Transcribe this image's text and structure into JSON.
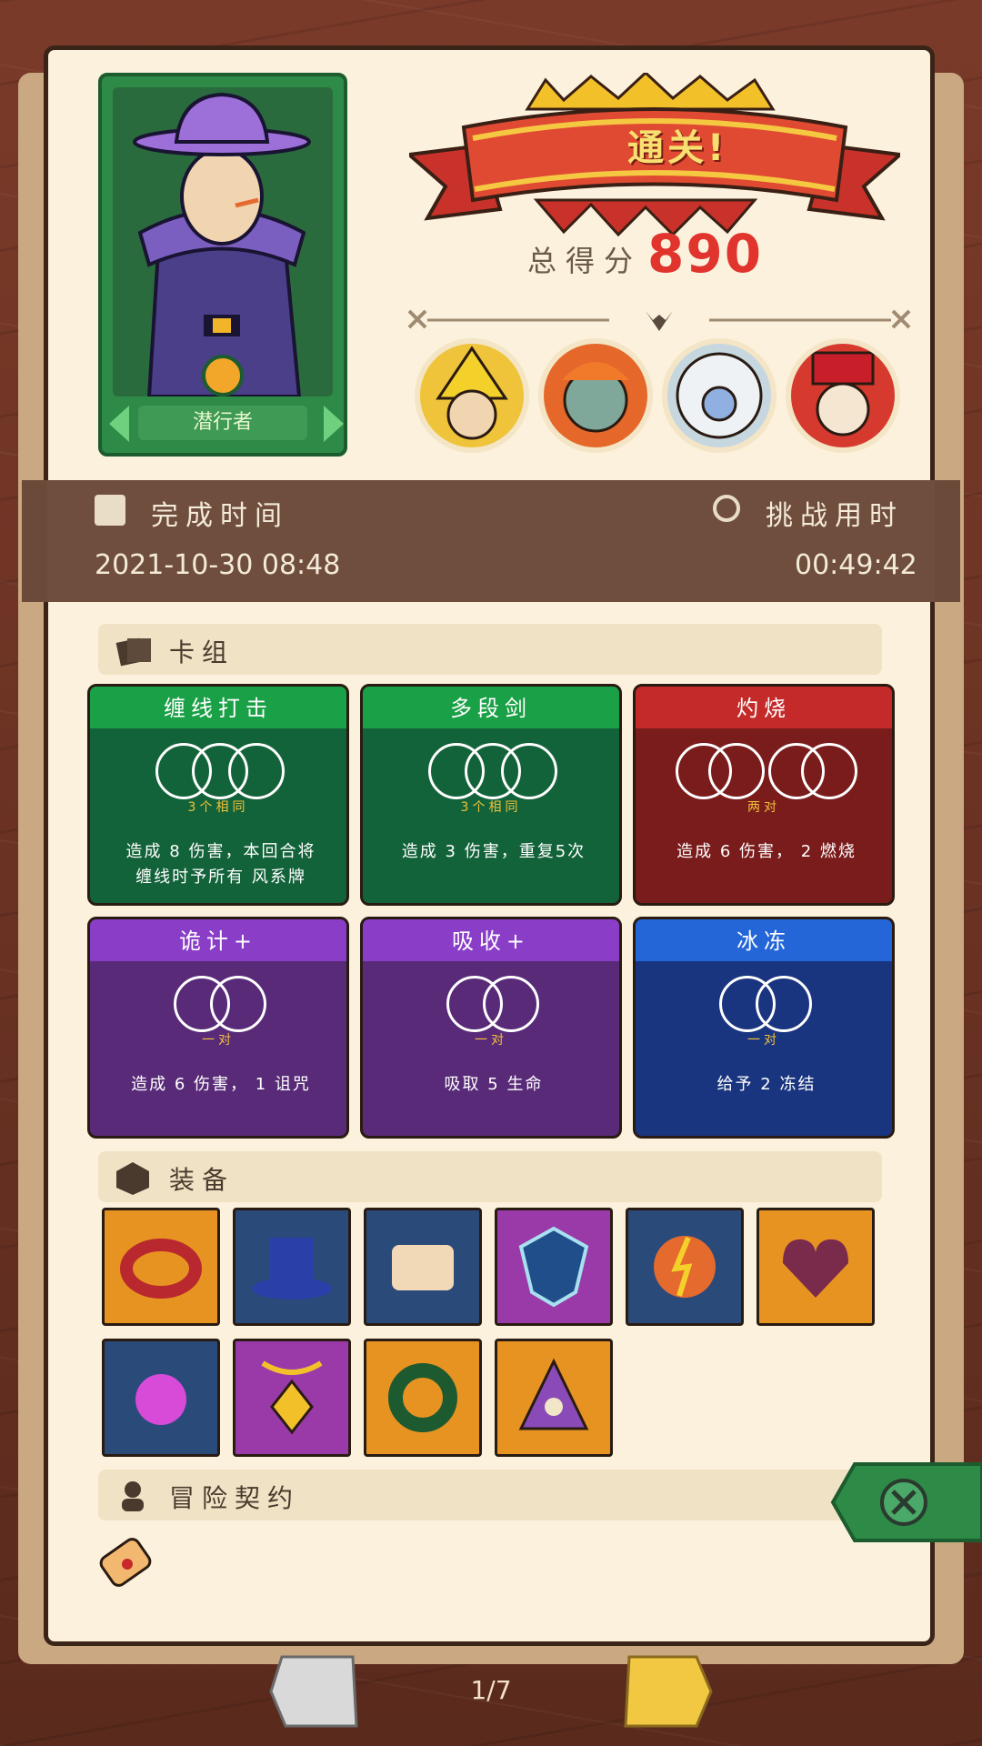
{
  "hero": {
    "name": "潜行者"
  },
  "banner": {
    "title": "通关!"
  },
  "score": {
    "label": "总得分",
    "value": "890"
  },
  "time": {
    "complete_label": "完成时间",
    "complete_value": "2021-10-30 08:48",
    "challenge_label": "挑战用时",
    "challenge_value": "00:49:42"
  },
  "sections": {
    "deck": "卡组",
    "equipment": "装备",
    "contract": "冒险契约"
  },
  "cards": [
    {
      "title": "缠线打击",
      "sub": "3个相同",
      "desc1": "造成 8 伤害，本回合将",
      "desc2": "缠线时予所有 风系牌",
      "color": "green"
    },
    {
      "title": "多段剑",
      "sub": "3个相同",
      "desc1": "造成 3 伤害，重复5次",
      "desc2": "",
      "color": "green"
    },
    {
      "title": "灼烧",
      "sub": "两对",
      "desc1": "造成 6 伤害， 2 燃烧",
      "desc2": "",
      "color": "red"
    },
    {
      "title": "诡计+",
      "sub": "一对",
      "desc1": "造成 6 伤害， 1 诅咒",
      "desc2": "",
      "color": "purple"
    },
    {
      "title": "吸收+",
      "sub": "一对",
      "desc1": "吸取 5 生命",
      "desc2": "",
      "color": "purple"
    },
    {
      "title": "冰冻",
      "sub": "一对",
      "desc1": "给予 2 冻结",
      "desc2": "",
      "color": "blue"
    }
  ],
  "equipment_icons": [
    "spiked-bracelet-icon",
    "top-hat-icon",
    "scroll-icon",
    "shield-mask-icon",
    "lightning-orb-icon",
    "cursed-heart-icon",
    "purple-splash-icon",
    "amulet-icon",
    "serpent-ring-icon",
    "eye-flask-icon"
  ],
  "pager": "1/7",
  "colors": {
    "paper": "#fbf1dc",
    "score": "#e0342d",
    "band": "#6f4e3d"
  }
}
